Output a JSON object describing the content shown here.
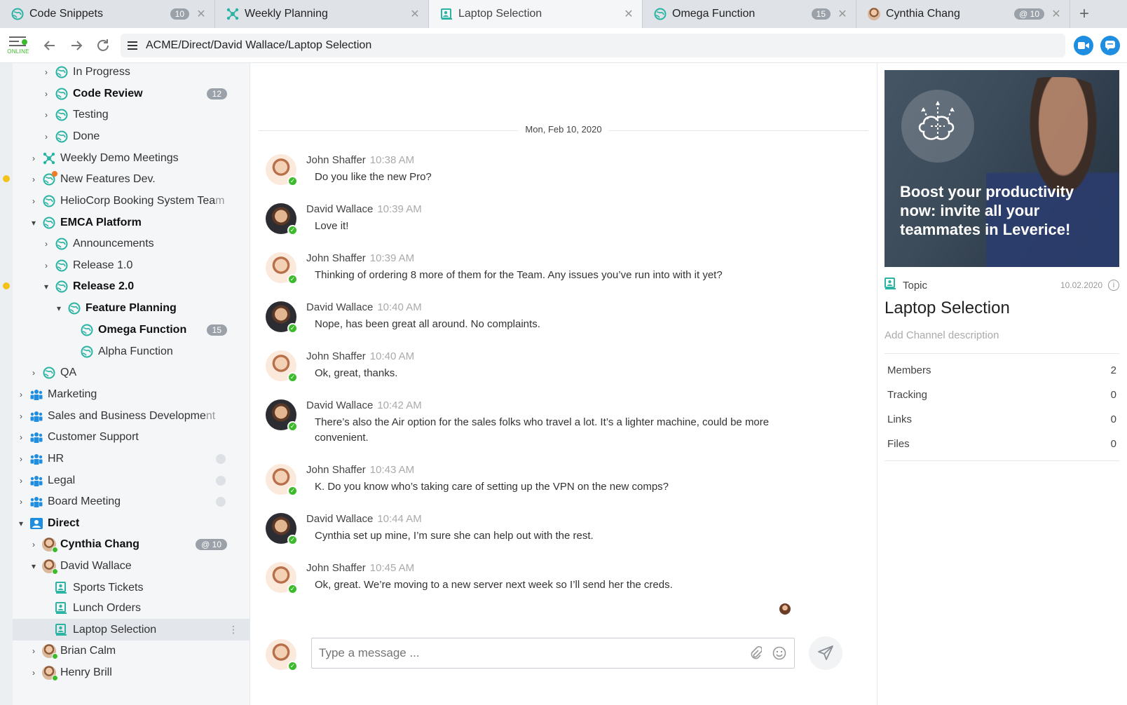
{
  "tabs": [
    {
      "label": "Code Snippets",
      "badge": "10",
      "active": false,
      "icon": "globe-icon"
    },
    {
      "label": "Weekly Planning",
      "badge": "",
      "active": false,
      "icon": "network-icon"
    },
    {
      "label": "Laptop Selection",
      "badge": "",
      "active": true,
      "icon": "topic-icon"
    },
    {
      "label": "Omega Function",
      "badge": "15",
      "active": false,
      "icon": "globe-icon"
    },
    {
      "label": "Cynthia Chang",
      "badge": "@ 10",
      "active": false,
      "icon": "avatar"
    }
  ],
  "address": {
    "status": "ONLINE",
    "path": "ACME/Direct/David Wallace/Laptop Selection"
  },
  "sidebar": {
    "items": [
      {
        "label": "In Progress"
      },
      {
        "label": "Code Review",
        "badge": "12"
      },
      {
        "label": "Testing"
      },
      {
        "label": "Done"
      },
      {
        "label": "Weekly Demo Meetings"
      },
      {
        "label": "New Features Dev."
      },
      {
        "label": "HelioCorp Booking System Tea",
        "fade": "m"
      },
      {
        "label": "EMCA Platform"
      },
      {
        "label": "Announcements"
      },
      {
        "label": "Release 1.0"
      },
      {
        "label": "Release 2.0"
      },
      {
        "label": "Feature Planning"
      },
      {
        "label": "Omega Function",
        "badge": "15"
      },
      {
        "label": "Alpha Function"
      },
      {
        "label": "QA"
      },
      {
        "label": "Marketing"
      },
      {
        "label": "Sales and Business Developme",
        "fade": "nt"
      },
      {
        "label": "Customer Support"
      },
      {
        "label": "HR"
      },
      {
        "label": "Legal"
      },
      {
        "label": "Board Meeting"
      },
      {
        "label": "Direct"
      },
      {
        "label": "Cynthia Chang",
        "badge": "@ 10"
      },
      {
        "label": "David Wallace"
      },
      {
        "label": "Sports Tickets"
      },
      {
        "label": "Lunch Orders"
      },
      {
        "label": "Laptop Selection"
      },
      {
        "label": "Brian Calm"
      },
      {
        "label": "Henry Brill"
      }
    ]
  },
  "chat": {
    "date": "Mon, Feb 10, 2020",
    "messages": [
      {
        "author": "John Shaffer",
        "time": "10:38 AM",
        "text": "Do you like the new Pro?"
      },
      {
        "author": "David Wallace",
        "time": "10:39 AM",
        "text": "Love it!"
      },
      {
        "author": "John Shaffer",
        "time": "10:39 AM",
        "text": "Thinking of ordering 8 more of them for the Team. Any issues you’ve run into with it yet?"
      },
      {
        "author": "David Wallace",
        "time": "10:40 AM",
        "text": "Nope, has been great all around. No complaints."
      },
      {
        "author": "John Shaffer",
        "time": "10:40 AM",
        "text": "Ok, great, thanks."
      },
      {
        "author": "David Wallace",
        "time": "10:42 AM",
        "text": "There’s also the Air option for the sales folks who travel a lot. It’s a lighter machine, could be more convenient."
      },
      {
        "author": "John Shaffer",
        "time": "10:43 AM",
        "text": "K. Do you know who’s taking care of setting up the VPN on the new comps?"
      },
      {
        "author": "David Wallace",
        "time": "10:44 AM",
        "text": "Cynthia set up mine, I’m sure she can help out with the rest."
      },
      {
        "author": "John Shaffer",
        "time": "10:45 AM",
        "text": "Ok, great. We’re moving to a new server next week so I’ll send her the creds."
      }
    ],
    "composer_placeholder": "Type a message ..."
  },
  "panel": {
    "promo": "Boost your productivity now: invite all your teammates in Leverice!",
    "topic_label": "Topic",
    "topic_date": "10.02.2020",
    "channel_title": "Laptop Selection",
    "channel_desc": "Add Channel description",
    "stats": [
      {
        "label": "Members",
        "value": "2"
      },
      {
        "label": "Tracking",
        "value": "0"
      },
      {
        "label": "Links",
        "value": "0"
      },
      {
        "label": "Files",
        "value": "0"
      }
    ]
  },
  "colors": {
    "accent": "#1f8de0",
    "teal": "#2bb3a3",
    "online": "#3bba2a",
    "unread": "#f3c21b"
  }
}
